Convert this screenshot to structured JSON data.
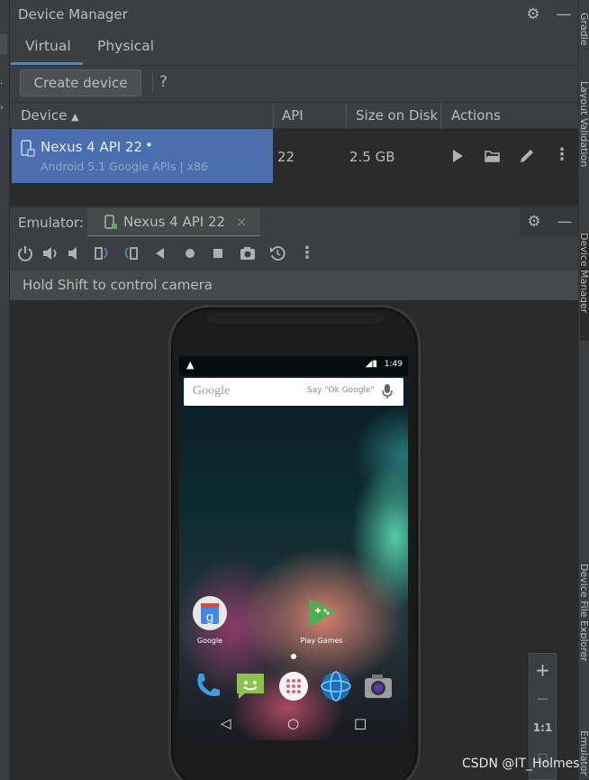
{
  "device_manager": {
    "title": "Device Manager",
    "tabs": [
      "Virtual",
      "Physical"
    ],
    "active_tab": "Virtual",
    "create_button": "Create device",
    "help": "?",
    "columns": [
      "Device",
      "API",
      "Size on Disk",
      "Actions"
    ],
    "rows": [
      {
        "name": "Nexus 4 API 22",
        "status_dot": "•",
        "subtitle": "Android 5.1 Google APIs | x86",
        "api": "22",
        "size": "2.5 GB"
      }
    ]
  },
  "emulator": {
    "label": "Emulator:",
    "tab_title": "Nexus 4 API 22",
    "hint": "Hold Shift to control camera",
    "phone": {
      "status_time": "1:49",
      "search_brand": "Google",
      "search_hint": "Say \"Ok Google\"",
      "apps": [
        {
          "label": "Google"
        },
        {
          "label": "Play Games"
        }
      ]
    },
    "zoom": {
      "zoom_in": "+",
      "zoom_out": "−",
      "actual_size": "1:1"
    }
  },
  "right_tool_tabs": [
    "Gradle",
    "Layout Validation",
    "Device Manager",
    "Device File Explorer",
    "Emulator"
  ],
  "watermark": "CSDN @IT_Holmes",
  "colors": {
    "accent": "#4a88c7",
    "selection": "#4b6eaf",
    "panel": "#3c3f41",
    "background": "#2b2b2b"
  }
}
